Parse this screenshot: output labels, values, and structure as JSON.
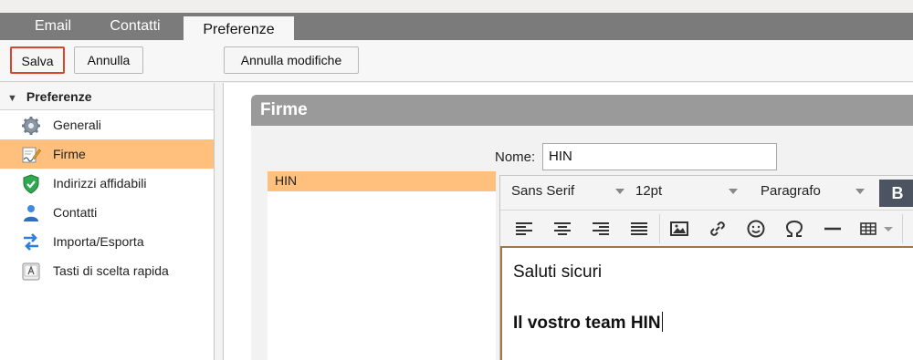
{
  "tabs": [
    {
      "label": "Email"
    },
    {
      "label": "Contatti"
    },
    {
      "label": "Preferenze"
    }
  ],
  "toolbar": {
    "save_label": "Salva",
    "cancel_label": "Annulla",
    "undo_label": "Annulla modifiche"
  },
  "sidebar": {
    "header": "Preferenze",
    "items": [
      {
        "label": "Generali",
        "icon": "gear-icon"
      },
      {
        "label": "Firme",
        "icon": "signature-icon"
      },
      {
        "label": "Indirizzi affidabili",
        "icon": "shield-check-icon"
      },
      {
        "label": "Contatti",
        "icon": "contact-person-icon"
      },
      {
        "label": "Importa/Esporta",
        "icon": "import-export-icon"
      },
      {
        "label": "Tasti di scelta rapida",
        "icon": "keyboard-key-icon"
      }
    ],
    "selected_index": 1
  },
  "main": {
    "title": "Firme",
    "signatures": [
      {
        "label": "HIN"
      }
    ],
    "name_label": "Nome:",
    "name_value": "HIN"
  },
  "editor": {
    "font_family": "Sans Serif",
    "font_size": "12pt",
    "block_format": "Paragrafo",
    "bold_label": "B",
    "content": {
      "line1": "Saluti sicuri",
      "line2": "Il vostro team HIN"
    }
  },
  "colors": {
    "accent_selected": "#ffc07d",
    "save_border": "#d9472b",
    "tab_bar": "#7b7b7b",
    "card_header": "#9a9a9a"
  }
}
